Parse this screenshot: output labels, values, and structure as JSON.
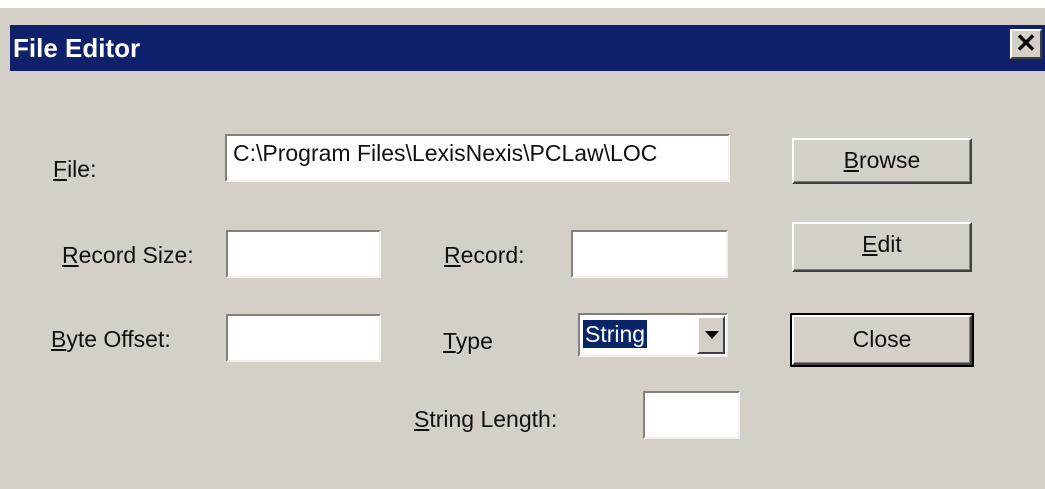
{
  "window": {
    "title": "File Editor",
    "close_glyph": "✕"
  },
  "labels": {
    "file_mn": "F",
    "file_rest": "ile:",
    "record_size_mn": "R",
    "record_size_rest": "ecord Size:",
    "record_mn": "R",
    "record_rest": "ecord:",
    "byte_offset_mn": "B",
    "byte_offset_rest": "yte Offset:",
    "type_mn": "T",
    "type_rest": "ype",
    "string_length_mn": "S",
    "string_length_rest": "tring Length:"
  },
  "fields": {
    "file_path": "C:\\Program Files\\LexisNexis\\PCLaw\\LOC",
    "record_size": "",
    "record": "",
    "byte_offset": "",
    "string_length": ""
  },
  "type_select": {
    "selected": "String"
  },
  "buttons": {
    "browse_mn": "B",
    "browse_rest": "rowse",
    "edit_mn": "E",
    "edit_rest": "dit",
    "close": "Close"
  },
  "icons": {
    "dropdown": "chevron-down-icon",
    "close": "close-icon"
  },
  "colors": {
    "titlebar": "#10216b",
    "dialog_bg": "#d4d0c8",
    "selection": "#0a246a"
  }
}
